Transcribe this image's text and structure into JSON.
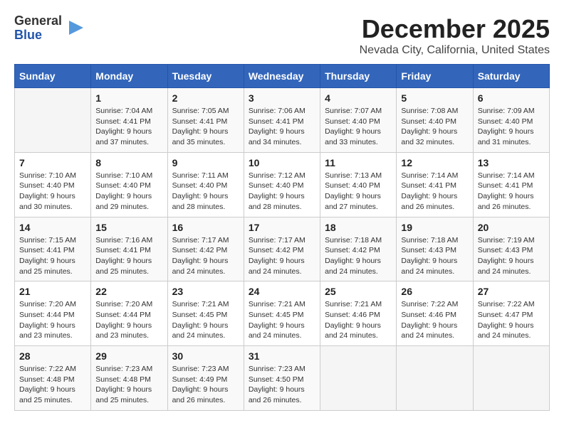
{
  "logo": {
    "general": "General",
    "blue": "Blue"
  },
  "title": "December 2025",
  "subtitle": "Nevada City, California, United States",
  "days_header": [
    "Sunday",
    "Monday",
    "Tuesday",
    "Wednesday",
    "Thursday",
    "Friday",
    "Saturday"
  ],
  "weeks": [
    [
      {
        "day": "",
        "info": ""
      },
      {
        "day": "1",
        "info": "Sunrise: 7:04 AM\nSunset: 4:41 PM\nDaylight: 9 hours\nand 37 minutes."
      },
      {
        "day": "2",
        "info": "Sunrise: 7:05 AM\nSunset: 4:41 PM\nDaylight: 9 hours\nand 35 minutes."
      },
      {
        "day": "3",
        "info": "Sunrise: 7:06 AM\nSunset: 4:41 PM\nDaylight: 9 hours\nand 34 minutes."
      },
      {
        "day": "4",
        "info": "Sunrise: 7:07 AM\nSunset: 4:40 PM\nDaylight: 9 hours\nand 33 minutes."
      },
      {
        "day": "5",
        "info": "Sunrise: 7:08 AM\nSunset: 4:40 PM\nDaylight: 9 hours\nand 32 minutes."
      },
      {
        "day": "6",
        "info": "Sunrise: 7:09 AM\nSunset: 4:40 PM\nDaylight: 9 hours\nand 31 minutes."
      }
    ],
    [
      {
        "day": "7",
        "info": "Sunrise: 7:10 AM\nSunset: 4:40 PM\nDaylight: 9 hours\nand 30 minutes."
      },
      {
        "day": "8",
        "info": "Sunrise: 7:10 AM\nSunset: 4:40 PM\nDaylight: 9 hours\nand 29 minutes."
      },
      {
        "day": "9",
        "info": "Sunrise: 7:11 AM\nSunset: 4:40 PM\nDaylight: 9 hours\nand 28 minutes."
      },
      {
        "day": "10",
        "info": "Sunrise: 7:12 AM\nSunset: 4:40 PM\nDaylight: 9 hours\nand 28 minutes."
      },
      {
        "day": "11",
        "info": "Sunrise: 7:13 AM\nSunset: 4:40 PM\nDaylight: 9 hours\nand 27 minutes."
      },
      {
        "day": "12",
        "info": "Sunrise: 7:14 AM\nSunset: 4:41 PM\nDaylight: 9 hours\nand 26 minutes."
      },
      {
        "day": "13",
        "info": "Sunrise: 7:14 AM\nSunset: 4:41 PM\nDaylight: 9 hours\nand 26 minutes."
      }
    ],
    [
      {
        "day": "14",
        "info": "Sunrise: 7:15 AM\nSunset: 4:41 PM\nDaylight: 9 hours\nand 25 minutes."
      },
      {
        "day": "15",
        "info": "Sunrise: 7:16 AM\nSunset: 4:41 PM\nDaylight: 9 hours\nand 25 minutes."
      },
      {
        "day": "16",
        "info": "Sunrise: 7:17 AM\nSunset: 4:42 PM\nDaylight: 9 hours\nand 24 minutes."
      },
      {
        "day": "17",
        "info": "Sunrise: 7:17 AM\nSunset: 4:42 PM\nDaylight: 9 hours\nand 24 minutes."
      },
      {
        "day": "18",
        "info": "Sunrise: 7:18 AM\nSunset: 4:42 PM\nDaylight: 9 hours\nand 24 minutes."
      },
      {
        "day": "19",
        "info": "Sunrise: 7:18 AM\nSunset: 4:43 PM\nDaylight: 9 hours\nand 24 minutes."
      },
      {
        "day": "20",
        "info": "Sunrise: 7:19 AM\nSunset: 4:43 PM\nDaylight: 9 hours\nand 24 minutes."
      }
    ],
    [
      {
        "day": "21",
        "info": "Sunrise: 7:20 AM\nSunset: 4:44 PM\nDaylight: 9 hours\nand 23 minutes."
      },
      {
        "day": "22",
        "info": "Sunrise: 7:20 AM\nSunset: 4:44 PM\nDaylight: 9 hours\nand 23 minutes."
      },
      {
        "day": "23",
        "info": "Sunrise: 7:21 AM\nSunset: 4:45 PM\nDaylight: 9 hours\nand 24 minutes."
      },
      {
        "day": "24",
        "info": "Sunrise: 7:21 AM\nSunset: 4:45 PM\nDaylight: 9 hours\nand 24 minutes."
      },
      {
        "day": "25",
        "info": "Sunrise: 7:21 AM\nSunset: 4:46 PM\nDaylight: 9 hours\nand 24 minutes."
      },
      {
        "day": "26",
        "info": "Sunrise: 7:22 AM\nSunset: 4:46 PM\nDaylight: 9 hours\nand 24 minutes."
      },
      {
        "day": "27",
        "info": "Sunrise: 7:22 AM\nSunset: 4:47 PM\nDaylight: 9 hours\nand 24 minutes."
      }
    ],
    [
      {
        "day": "28",
        "info": "Sunrise: 7:22 AM\nSunset: 4:48 PM\nDaylight: 9 hours\nand 25 minutes."
      },
      {
        "day": "29",
        "info": "Sunrise: 7:23 AM\nSunset: 4:48 PM\nDaylight: 9 hours\nand 25 minutes."
      },
      {
        "day": "30",
        "info": "Sunrise: 7:23 AM\nSunset: 4:49 PM\nDaylight: 9 hours\nand 26 minutes."
      },
      {
        "day": "31",
        "info": "Sunrise: 7:23 AM\nSunset: 4:50 PM\nDaylight: 9 hours\nand 26 minutes."
      },
      {
        "day": "",
        "info": ""
      },
      {
        "day": "",
        "info": ""
      },
      {
        "day": "",
        "info": ""
      }
    ]
  ]
}
